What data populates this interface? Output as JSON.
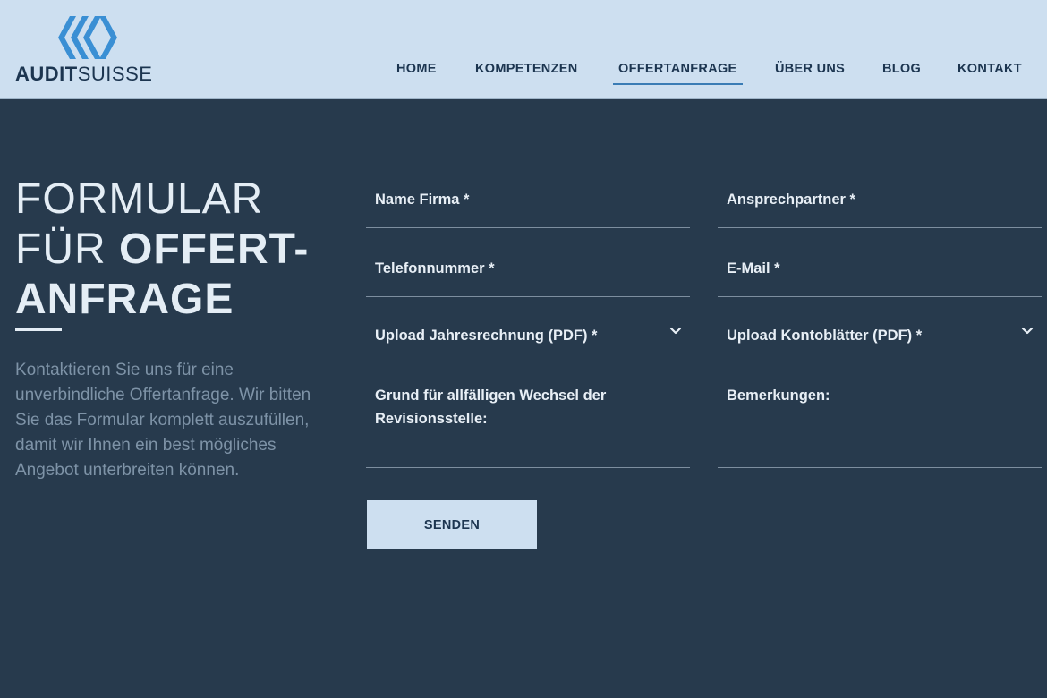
{
  "brand": {
    "name_bold": "AUDIT",
    "name_light": "SUISSE",
    "icon": "audit-suisse-logo-icon"
  },
  "nav": {
    "items": [
      {
        "label": "HOME",
        "active": false
      },
      {
        "label": "KOMPETENZEN",
        "active": false
      },
      {
        "label": "OFFERTANFRAGE",
        "active": true
      },
      {
        "label": "ÜBER UNS",
        "active": false
      },
      {
        "label": "BLOG",
        "active": false
      },
      {
        "label": "KONTAKT",
        "active": false
      }
    ]
  },
  "hero": {
    "title_line1": "FORMULAR",
    "title_line2_thin": "FÜR",
    "title_line2_bold": "OFFERT-",
    "title_line3": "ANFRAGE",
    "intro": "Kontaktieren Sie uns für eine unverbindliche Offertanfrage. Wir bitten Sie das Formular komplett auszufüllen, damit wir Ihnen ein best mögliches Angebot unterbreiten können."
  },
  "form": {
    "company_name": "Name Firma *",
    "contact_person": "Ansprechpartner *",
    "phone": "Telefonnummer *",
    "email": "E-Mail *",
    "upload_annual_accounts": "Upload Jahresrechnung (PDF) *",
    "upload_account_sheets": "Upload Kontoblätter (PDF) *",
    "reason_for_change": "Grund für allfälligen Wechsel der Revisionsstelle:",
    "remarks": "Bemerkungen:",
    "submit": "SENDEN"
  },
  "colors": {
    "header_bg": "#cddff0",
    "page_bg": "#273a4d",
    "brand_blue": "#3a8fd4",
    "nav_text": "#1c3550",
    "active_underline": "#3a7cb5"
  }
}
